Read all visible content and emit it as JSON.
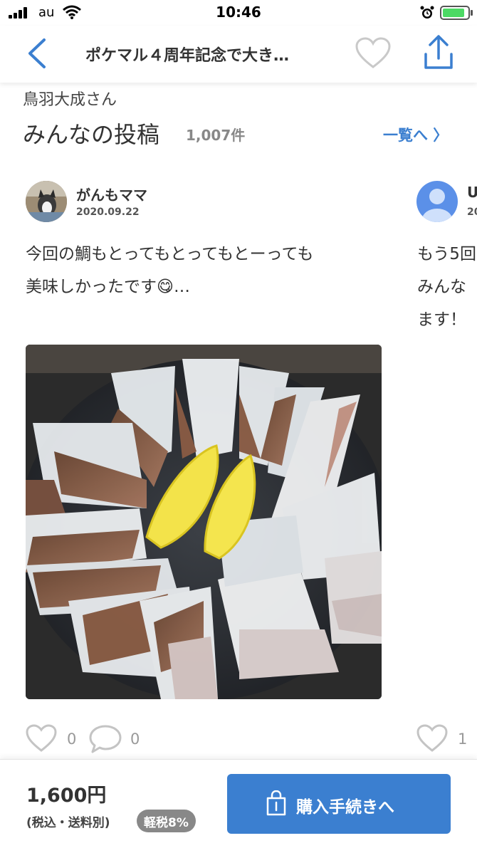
{
  "status_bar": {
    "carrier": "au",
    "time": "10:46"
  },
  "nav": {
    "title": "ポケマル４周年記念で大き…"
  },
  "section": {
    "brand": "鳥羽大成さん",
    "title": "みんなの投稿",
    "count": "1,007件",
    "see_all": "一覧へ 〉"
  },
  "posts": [
    {
      "username": "がんもママ",
      "date": "2020.09.22",
      "body_line1": "今回の鯛もとってもとってもとーっても",
      "body_line2": "美味しかったです😋…",
      "likes": "0",
      "comments": "0"
    },
    {
      "username": "U",
      "date": "20",
      "body_line1": "もう5回",
      "body_line2": "みんな",
      "body_line3": "ます！",
      "likes": "1"
    }
  ],
  "purchase": {
    "price": "1,600円",
    "tax_note": "(税込・送料別)",
    "tax_badge": "軽税8%",
    "button_label": "購入手続きへ"
  },
  "colors": {
    "accent": "#3b7fd0",
    "badge": "#888888",
    "battery": "#4cd964"
  }
}
